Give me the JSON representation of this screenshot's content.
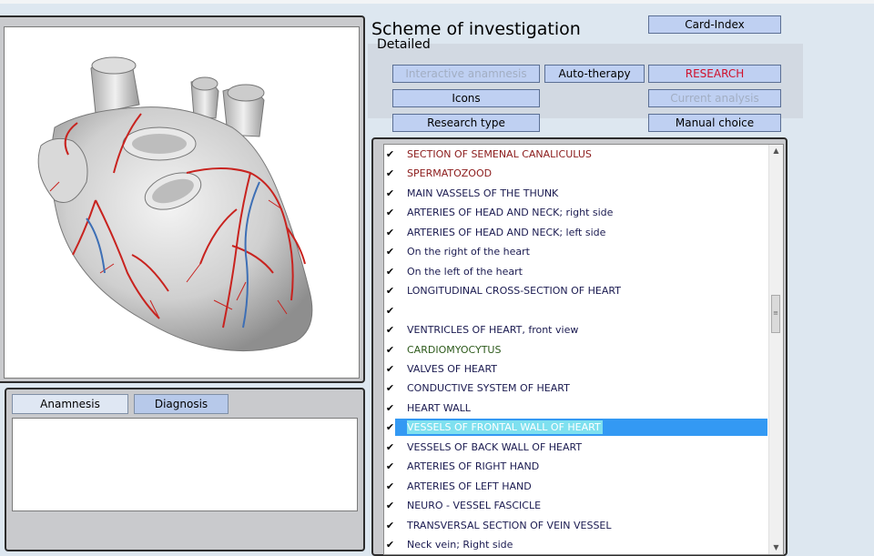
{
  "header": {
    "title": "Scheme of investigation",
    "subtitle": "Detailed"
  },
  "buttons": {
    "card_index": "Card-Index",
    "interactive_anamnesis": "Interactive anamnesis",
    "auto_therapy": "Auto-therapy",
    "research": "RESEARCH",
    "icons": "Icons",
    "current_analysis": "Current analysis",
    "research_type": "Research type",
    "manual_choice": "Manual choice"
  },
  "tabs": {
    "anamnesis": "Anamnesis",
    "diagnosis": "Diagnosis"
  },
  "colors": {
    "red_label": "#8b1a1a",
    "green_label": "#2d5a1b",
    "navy_label": "#1a1a50",
    "selection": "#3399f3"
  },
  "list": {
    "items": [
      {
        "label": "SECTION OF SEMENAL CANALICULUS",
        "checked": true,
        "color": "#8b1a1a"
      },
      {
        "label": "SPERMATOZOOD",
        "checked": true,
        "color": "#8b1a1a"
      },
      {
        "label": "MAIN  VASSELS  OF  THE  THUNK",
        "checked": true,
        "color": "#1a1a50"
      },
      {
        "label": "ARTERIES OF HEAD AND NECK; right side",
        "checked": true,
        "color": "#1a1a50"
      },
      {
        "label": "ARTERIES OF HEAD AND NECK; left side",
        "checked": true,
        "color": "#1a1a50"
      },
      {
        "label": "On the right of the heart",
        "checked": true,
        "color": "#1a1a50"
      },
      {
        "label": "On the left of the heart",
        "checked": true,
        "color": "#1a1a50"
      },
      {
        "label": "LONGITUDINAL CROSS-SECTION OF HEART",
        "checked": true,
        "color": "#1a1a50"
      },
      {
        "label": "",
        "checked": true,
        "color": "#1a1a50"
      },
      {
        "label": "VENTRICLES OF HEART, front view",
        "checked": true,
        "color": "#1a1a50"
      },
      {
        "label": "CARDIOMYOCYTUS",
        "checked": true,
        "color": "#2d5a1b"
      },
      {
        "label": "VALVES OF HEART",
        "checked": true,
        "color": "#1a1a50"
      },
      {
        "label": "CONDUCTIVE SYSTEM OF HEART",
        "checked": true,
        "color": "#1a1a50"
      },
      {
        "label": "HEART WALL",
        "checked": true,
        "color": "#1a1a50"
      },
      {
        "label": "VESSELS OF FRONTAL WALL OF HEART",
        "checked": true,
        "color": "#ffffff",
        "selected": true
      },
      {
        "label": "VESSELS OF BACK WALL OF HEART",
        "checked": true,
        "color": "#1a1a50"
      },
      {
        "label": "ARTERIES OF RIGHT HAND",
        "checked": true,
        "color": "#1a1a50"
      },
      {
        "label": "ARTERIES OF LEFT HAND",
        "checked": true,
        "color": "#1a1a50"
      },
      {
        "label": "NEURO - VESSEL  FASCICLE",
        "checked": true,
        "color": "#1a1a50"
      },
      {
        "label": "TRANSVERSAL SECTION OF VEIN VESSEL",
        "checked": true,
        "color": "#1a1a50"
      },
      {
        "label": "Neck vein; Right side",
        "checked": true,
        "color": "#1a1a50"
      }
    ]
  },
  "icons": {
    "checkbox": "checkmark-icon",
    "scroll_up": "arrow-up-icon",
    "scroll_down": "arrow-down-icon",
    "image": "heart-illustration"
  }
}
